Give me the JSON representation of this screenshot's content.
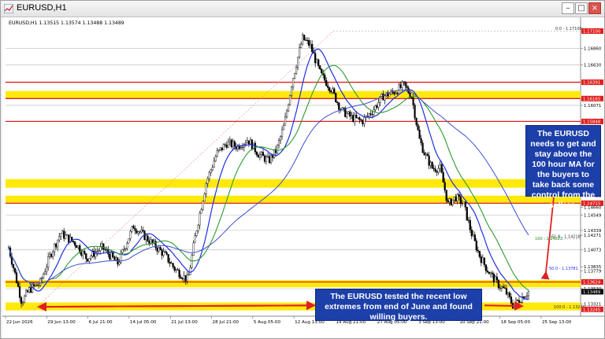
{
  "window": {
    "title": "EURUSD,H1",
    "min_glyph": "–",
    "max_glyph": "□",
    "close_glyph": "×"
  },
  "chart": {
    "header": {
      "symbol": "EURUSD,H1",
      "ohlc": "1.13515 1.13574 1.13488 1.13489"
    },
    "fib_labels": {
      "top": "0.0 - 1.17100",
      "mid": "61.8 - 1.14218",
      "bottom": "100.0 - 1.13245"
    },
    "ma_labels": {
      "ma200": "200 - 1.15163",
      "ma100": "100 - 1.14223",
      "ma50": "50.0 - 1.13781",
      "ma_sep": "1.13781"
    },
    "price_labels": [
      "1.17100",
      "1.16860",
      "1.16630",
      "1.16391",
      "1.16165",
      "1.16071",
      "1.15848",
      "1.15165",
      "1.14821",
      "1.14715",
      "1.14660",
      "1.14549",
      "1.14339",
      "1.14271",
      "1.14073",
      "1.13835",
      "1.13779",
      "1.13624",
      "1.13530",
      "1.13489",
      "1.13321",
      "1.13245"
    ],
    "time_labels": [
      "22 Jun 2026",
      "29 Jun 13:00",
      "6 Jul 21:00",
      "14 Jul 05:00",
      "21 Jul 13:00",
      "28 Jul 21:00",
      "5 Aug 05:00",
      "12 Aug 13:00",
      "19 Aug 21:00",
      "27 Aug 05:00",
      "3 Sep 13:00",
      "10 Sep 21:00",
      "18 Sep 05:00",
      "25 Sep 13:00"
    ],
    "price_range": [
      1.1315,
      1.1716
    ],
    "zones": [
      {
        "top": 1.1627,
        "bottom": 1.1616,
        "color": "#ffe800"
      },
      {
        "top": 1.1505,
        "bottom": 1.1493,
        "color": "#ffe800"
      },
      {
        "top": 1.1482,
        "bottom": 1.1471,
        "color": "#ffe800"
      },
      {
        "top": 1.1365,
        "bottom": 1.1355,
        "color": "#ffe800"
      },
      {
        "top": 1.1334,
        "bottom": 1.1323,
        "color": "#ffe800"
      }
    ],
    "red_levels": [
      1.16391,
      1.16165,
      1.15848,
      1.14715,
      1.13624
    ],
    "gray_levels": [
      1.1686,
      1.1663,
      1.16071,
      1.14549,
      1.14339,
      1.14073,
      1.1353
    ],
    "colors": {
      "candle": "#000000",
      "ma100": "#1f2fe0",
      "ma200": "#2e9a2e",
      "ma50_blue": "#1f2fe0",
      "red": "#e02020",
      "zone": "#ffe800",
      "callout_bg": "#1c3fa8"
    }
  },
  "callouts": {
    "right": "The EURUSD needs to get and stay above the 100 hour MA for the buyers to take back some control from the sellers.",
    "bottom": "The EURUSD tested the recent low extremes from end of June and found willing buyers."
  }
}
